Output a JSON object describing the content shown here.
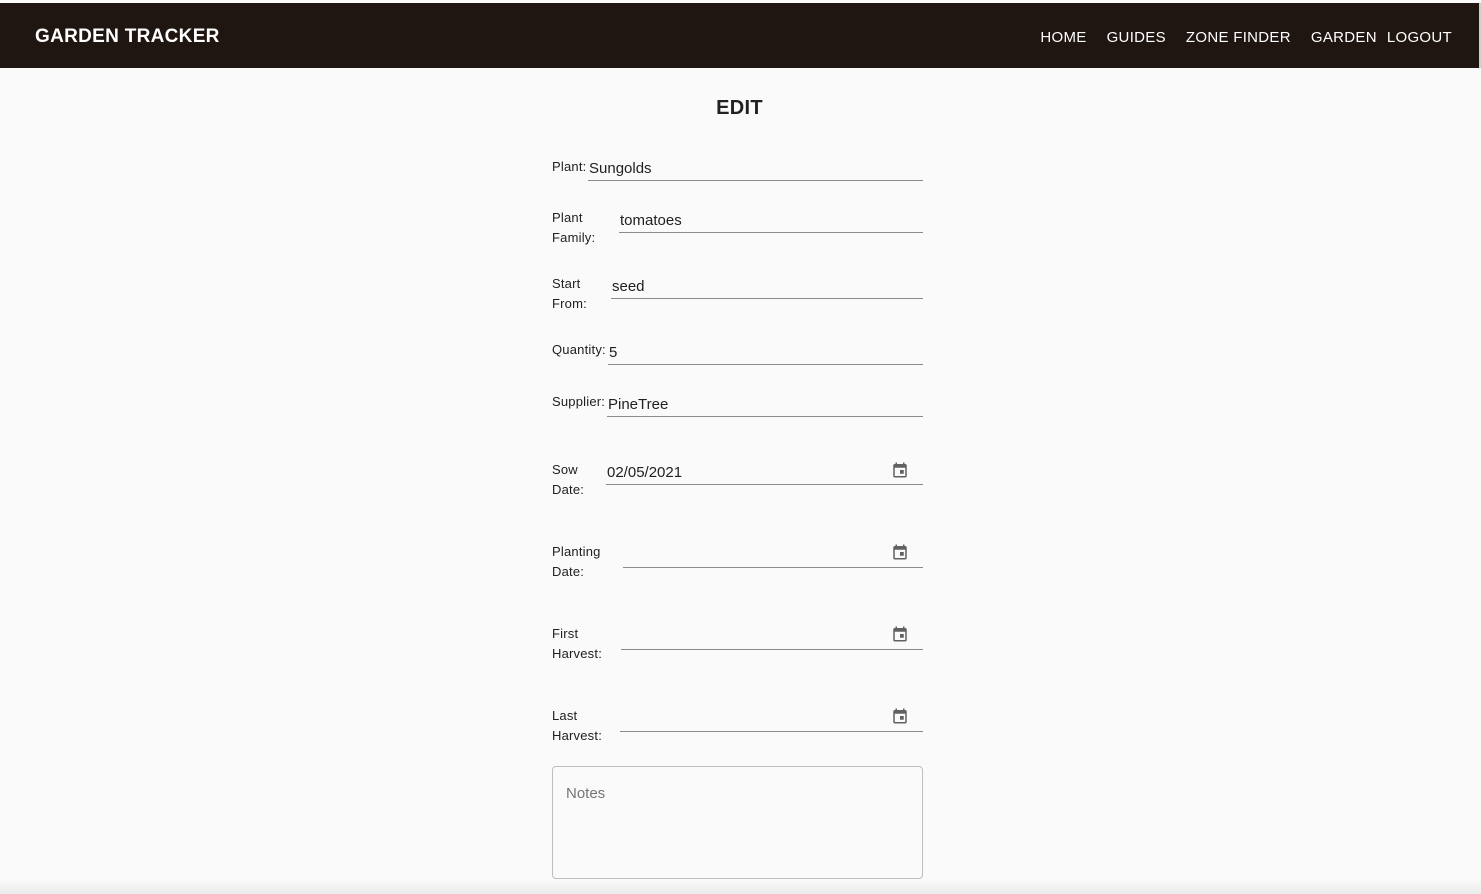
{
  "appbar": {
    "brand": "GARDEN TRACKER",
    "nav": [
      "HOME",
      "GUIDES",
      "ZONE FINDER",
      "GARDEN",
      "LOGOUT"
    ]
  },
  "page": {
    "title": "EDIT"
  },
  "form": {
    "plant": {
      "label": "Plant:",
      "value": "Sungolds"
    },
    "plant_family": {
      "label_line1": "Plant",
      "label_line2": "Family:",
      "value": "tomatoes"
    },
    "start_from": {
      "label_line1": "Start",
      "label_line2": "From:",
      "value": "seed"
    },
    "quantity": {
      "label": "Quantity:",
      "value": "5"
    },
    "supplier": {
      "label": "Supplier:",
      "value": "PineTree"
    },
    "sow_date": {
      "label_line1": "Sow",
      "label_line2": "Date:",
      "value": "02/05/2021",
      "icon": "calendar-icon"
    },
    "planting_date": {
      "label_line1": "Planting",
      "label_line2": "Date:",
      "value": "",
      "icon": "calendar-icon"
    },
    "first_harvest": {
      "label_line1": "First",
      "label_line2": "Harvest:",
      "value": "",
      "icon": "calendar-icon"
    },
    "last_harvest": {
      "label_line1": "Last",
      "label_line2": "Harvest:",
      "value": "",
      "icon": "calendar-icon"
    },
    "notes": {
      "placeholder": "Notes",
      "value": ""
    }
  },
  "colors": {
    "appbar_bg": "#1f1511",
    "page_bg": "#fafafa",
    "underline": "#8a8a8a"
  }
}
